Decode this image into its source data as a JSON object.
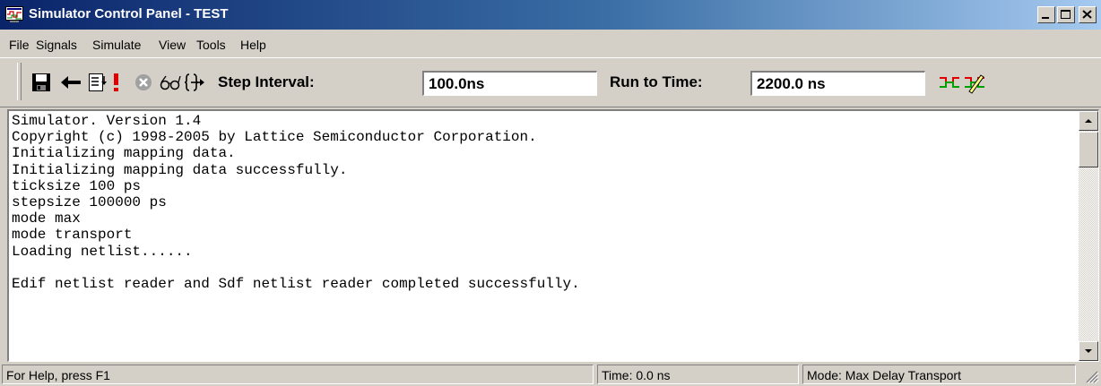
{
  "window": {
    "title": "Simulator Control Panel - TEST"
  },
  "menu": {
    "items": [
      "File",
      "Signals",
      "Simulate",
      "View",
      "Tools",
      "Help"
    ]
  },
  "toolbar": {
    "icons": [
      "save-icon",
      "back-arrow-icon",
      "list-icon",
      "run-exclamation-icon",
      "stop-icon",
      "glasses-icon",
      "step-into-icon",
      "waveform-icon",
      "waveform-edit-icon"
    ],
    "step_interval_label": "Step Interval:",
    "step_interval_value": "100.0ns",
    "run_to_time_label": "Run to Time:",
    "run_to_time_value": "2200.0 ns"
  },
  "console": {
    "lines": [
      "Simulator. Version 1.4",
      "Copyright (c) 1998-2005 by Lattice Semiconductor Corporation.",
      "Initializing mapping data.",
      "Initializing mapping data successfully.",
      "ticksize 100 ps",
      "stepsize 100000 ps",
      "mode max",
      "mode transport",
      "Loading netlist......",
      "",
      "Edif netlist reader and Sdf netlist reader completed successfully."
    ]
  },
  "status": {
    "help": "For Help, press F1",
    "time": "Time: 0.0 ns",
    "mode": "Mode: Max Delay  Transport"
  },
  "colors": {
    "titlebar_start": "#0a246a",
    "titlebar_end": "#a6caf0",
    "face": "#d4d0c8",
    "stop_icon": "#ff0000"
  }
}
